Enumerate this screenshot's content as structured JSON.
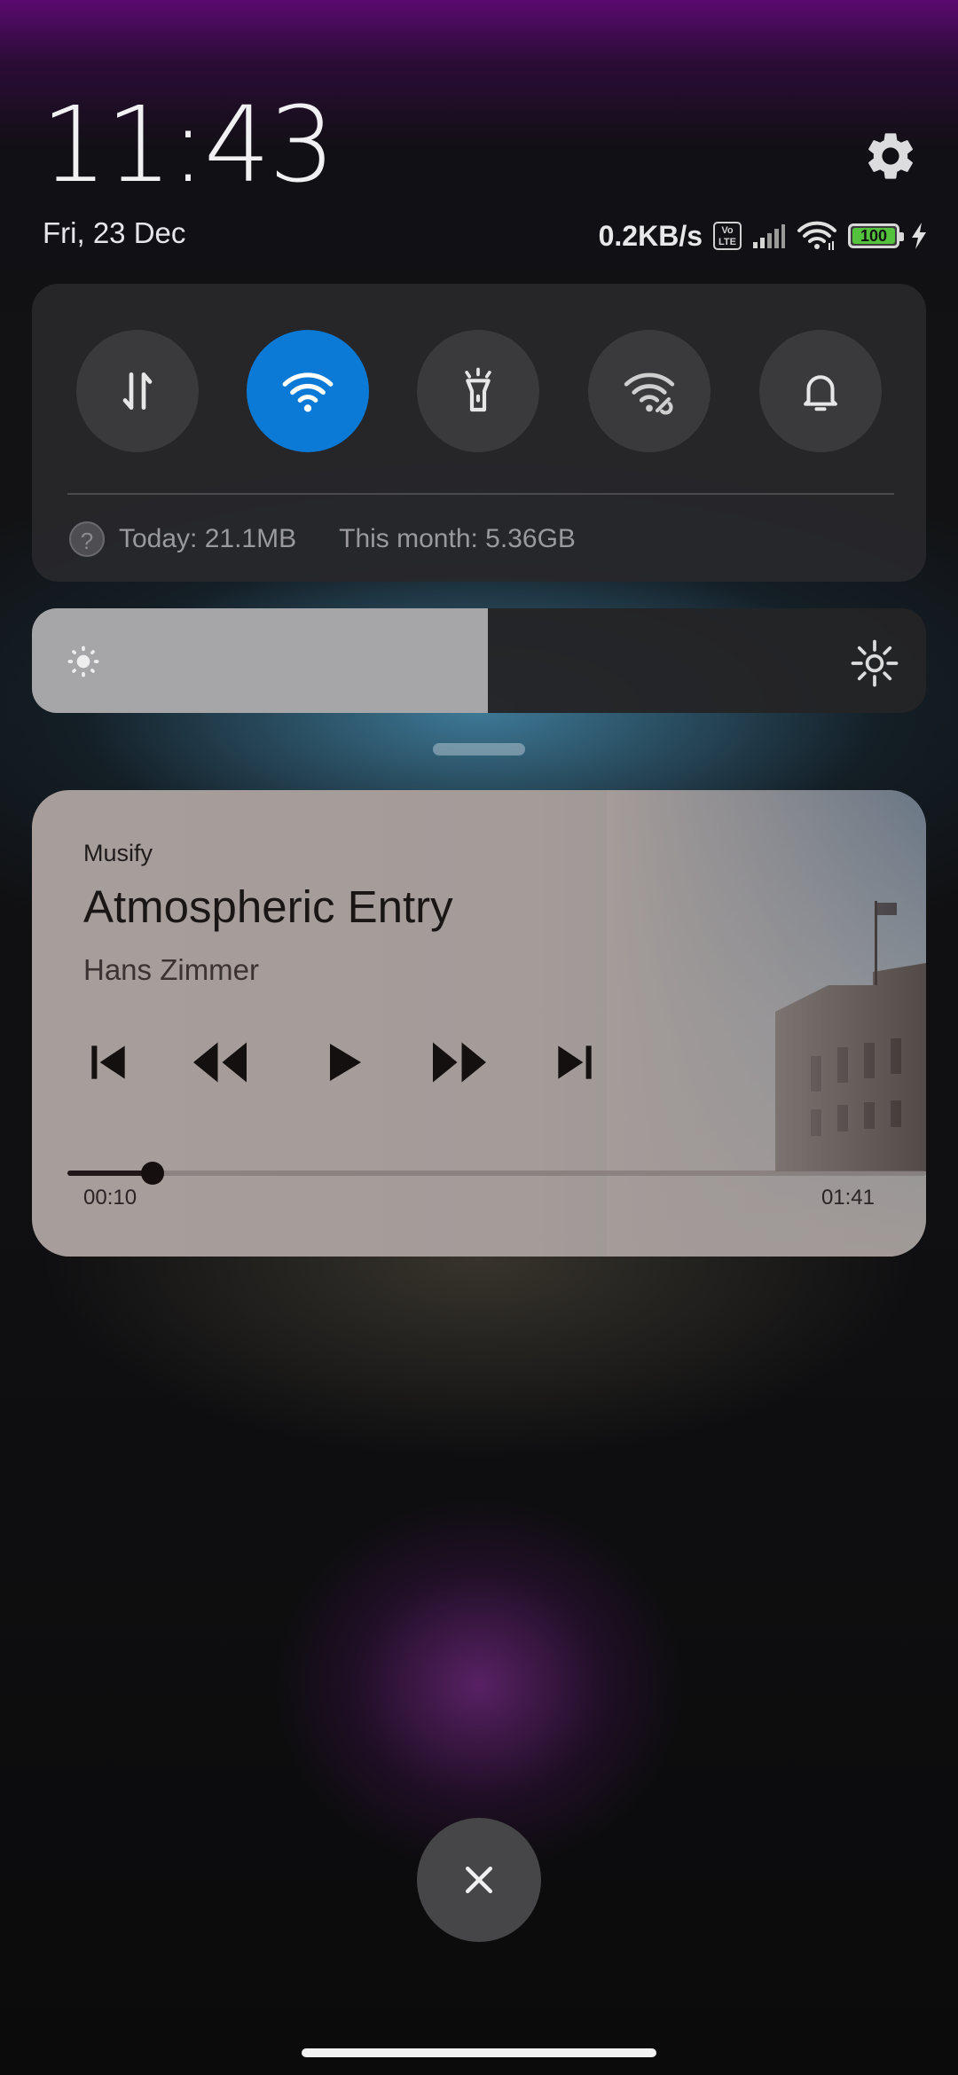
{
  "header": {
    "time": "11:43",
    "date": "Fri, 23 Dec",
    "settings_icon": "gear-icon"
  },
  "status_bar": {
    "network_speed": "0.2KB/s",
    "volte_badge": "Vo LTE",
    "signal_icon": "signal-bars-icon",
    "wifi_icon": "wifi-icon",
    "battery_level": "100",
    "charging_icon": "lightning-icon"
  },
  "quick_toggles": [
    {
      "name": "mobile-data",
      "icon": "data-transfer-icon",
      "active": false
    },
    {
      "name": "wifi",
      "icon": "wifi-icon",
      "active": true
    },
    {
      "name": "flashlight",
      "icon": "flashlight-icon",
      "active": false
    },
    {
      "name": "hotspot",
      "icon": "wifi-hotspot-icon",
      "active": false
    },
    {
      "name": "sound",
      "icon": "bell-icon",
      "active": false
    }
  ],
  "data_usage": {
    "today": "Today: 21.1MB",
    "month": "This month: 5.36GB"
  },
  "brightness": {
    "level": 0.51,
    "low_icon": "brightness-low-icon",
    "high_icon": "brightness-high-icon"
  },
  "media": {
    "app": "Musify",
    "title": "Atmospheric Entry",
    "artist": "Hans Zimmer",
    "elapsed": "00:10",
    "duration": "01:41",
    "progress": 0.099,
    "controls": [
      "skip-previous-icon",
      "rewind-icon",
      "play-icon",
      "fast-forward-icon",
      "skip-next-icon"
    ]
  },
  "colors": {
    "accent": "#0a7ad6",
    "battery_green": "#55c23d"
  }
}
